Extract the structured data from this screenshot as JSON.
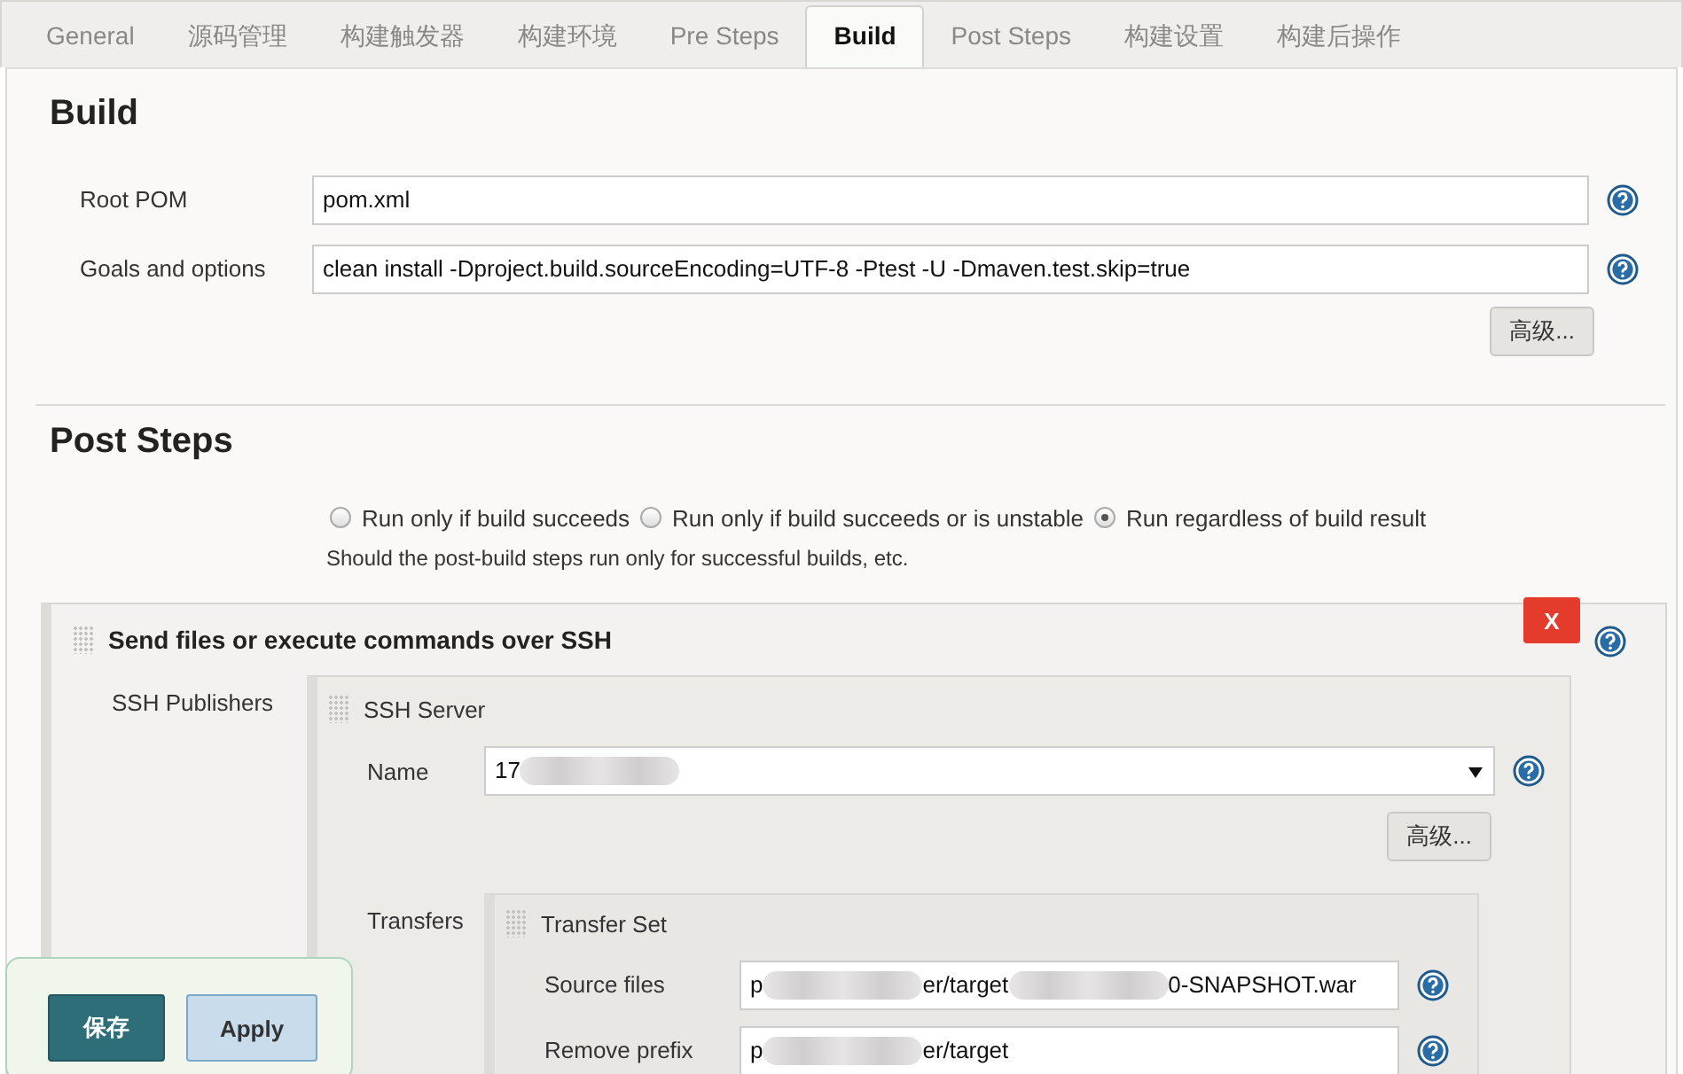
{
  "tabs": [
    {
      "label": "General",
      "selected": false
    },
    {
      "label": "源码管理",
      "selected": false
    },
    {
      "label": "构建触发器",
      "selected": false
    },
    {
      "label": "构建环境",
      "selected": false
    },
    {
      "label": "Pre Steps",
      "selected": false
    },
    {
      "label": "Build",
      "selected": true
    },
    {
      "label": "Post Steps",
      "selected": false
    },
    {
      "label": "构建设置",
      "selected": false
    },
    {
      "label": "构建后操作",
      "selected": false
    }
  ],
  "build": {
    "title": "Build",
    "fields": [
      {
        "label": "Root POM",
        "value": "pom.xml"
      },
      {
        "label": "Goals and options",
        "value": "clean install -Dproject.build.sourceEncoding=UTF-8 -Ptest -U -Dmaven.test.skip=true"
      }
    ],
    "advanced_button": "高级..."
  },
  "post_steps": {
    "title": "Post Steps",
    "options": [
      {
        "label": "Run only if build succeeds",
        "selected": false
      },
      {
        "label": "Run only if build succeeds or is unstable",
        "selected": false
      },
      {
        "label": "Run regardless of build result",
        "selected": true
      }
    ],
    "description": "Should the post-build steps run only for successful builds, etc.",
    "ssh_step": {
      "title": "Send files or execute commands over SSH",
      "delete_button": "X",
      "publishers_label": "SSH Publishers",
      "server": {
        "title": "SSH Server",
        "name_label": "Name",
        "name_value": [
          "17"
        ],
        "advanced_button": "高级...",
        "transfers_label": "Transfers",
        "transfer_set": {
          "title": "Transfer Set",
          "fields": [
            {
              "label": "Source files",
              "value": [
                "p",
                "er/target",
                "0-SNAPSHOT.war"
              ]
            },
            {
              "label": "Remove prefix",
              "value": [
                "p",
                "er/target"
              ]
            }
          ]
        }
      }
    }
  },
  "save_bar": {
    "save": "保存",
    "apply": "Apply"
  }
}
